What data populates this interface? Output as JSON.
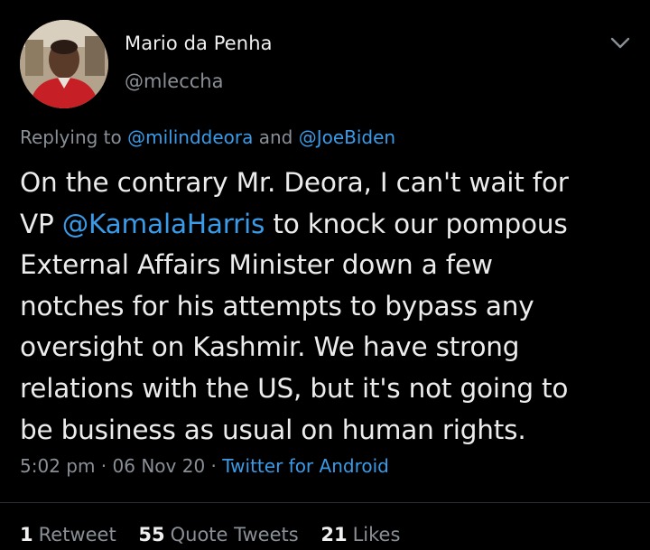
{
  "tweet": {
    "author": {
      "display_name": "Mario da Penha",
      "handle": "@mleccha",
      "avatar_icon": "profile-photo"
    },
    "menu_icon": "chevron-down-icon",
    "replying": {
      "prefix": "Replying to ",
      "mention1": "@milinddeora",
      "conjunction": " and ",
      "mention2": "@JoeBiden"
    },
    "body": {
      "line1": "On the contrary Mr. Deora, I can't wait for",
      "line2_prefix": "VP ",
      "line2_mention": "@KamalaHarris",
      "line2_suffix": " to knock our pompous",
      "line3": "External Affairs Minister down a few",
      "line4": "notches for his attempts to bypass any",
      "line5": "oversight on Kashmir. We have strong",
      "line6": "relations with the US, but it's not going to",
      "line7": "be business as usual on human rights."
    },
    "meta": {
      "time": "5:02 pm",
      "separator": " · ",
      "date": "06 Nov 20",
      "source": "Twitter for Android"
    },
    "stats": {
      "retweets_count": "1",
      "retweets_label": "Retweet",
      "quotes_count": "55",
      "quotes_label": "Quote Tweets",
      "likes_count": "21",
      "likes_label": "Likes"
    },
    "colors": {
      "background": "#000000",
      "link": "#3a9be8",
      "muted": "#8a8f96",
      "text": "#ececec"
    }
  }
}
